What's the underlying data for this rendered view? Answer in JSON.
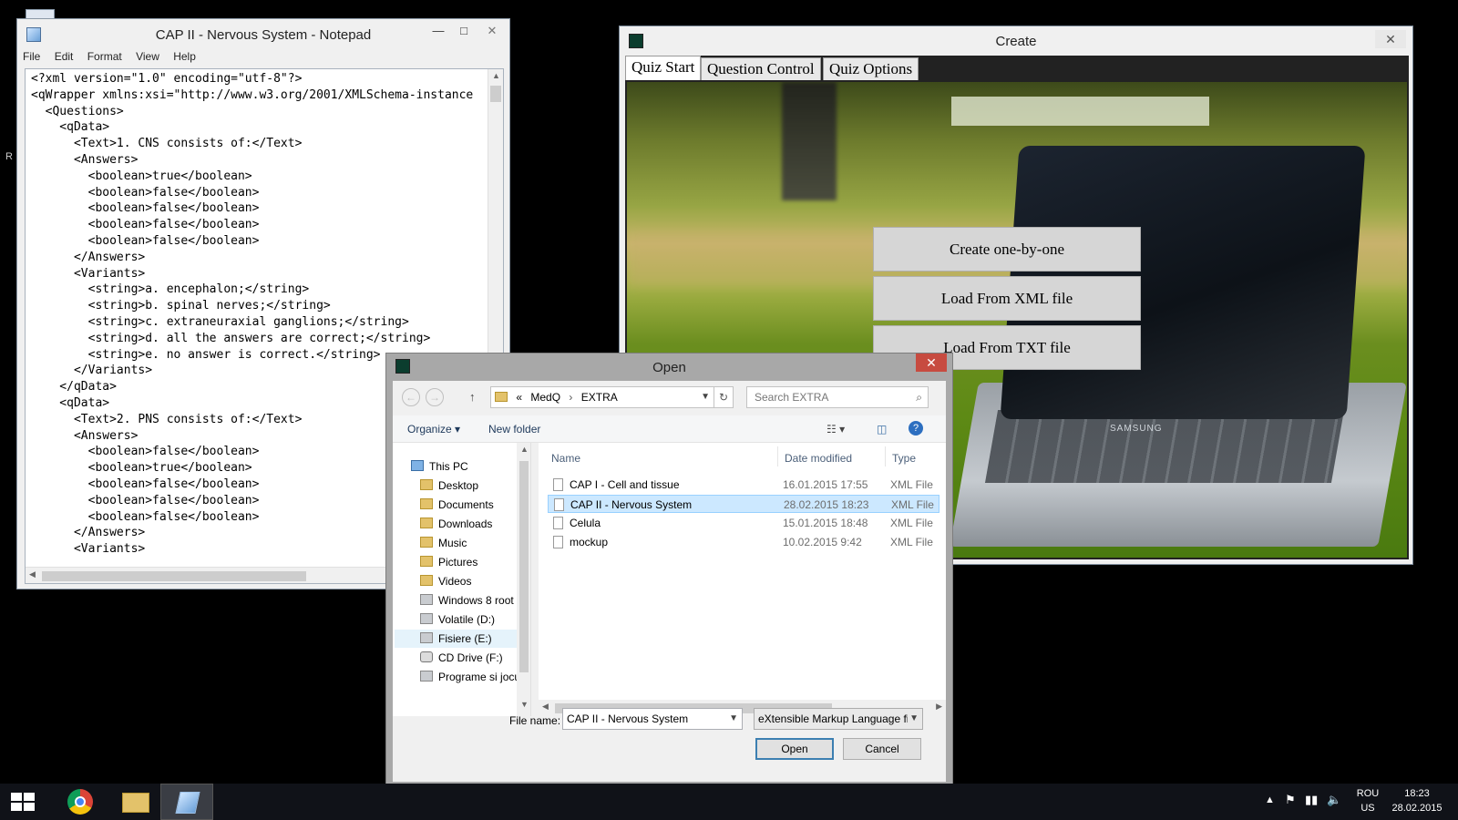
{
  "notepad": {
    "title": "CAP II - Nervous System - Notepad",
    "menu": [
      "File",
      "Edit",
      "Format",
      "View",
      "Help"
    ],
    "minimize": "—",
    "maximize": "□",
    "close": "✕",
    "content": "<?xml version=\"1.0\" encoding=\"utf-8\"?>\n<qWrapper xmlns:xsi=\"http://www.w3.org/2001/XMLSchema-instance\n  <Questions>\n    <qData>\n      <Text>1. CNS consists of:</Text>\n      <Answers>\n        <boolean>true</boolean>\n        <boolean>false</boolean>\n        <boolean>false</boolean>\n        <boolean>false</boolean>\n        <boolean>false</boolean>\n      </Answers>\n      <Variants>\n        <string>a. encephalon;</string>\n        <string>b. spinal nerves;</string>\n        <string>c. extraneuraxial ganglions;</string>\n        <string>d. all the answers are correct;</string>\n        <string>e. no answer is correct.</string>\n      </Variants>\n    </qData>\n    <qData>\n      <Text>2. PNS consists of:</Text>\n      <Answers>\n        <boolean>false</boolean>\n        <boolean>true</boolean>\n        <boolean>false</boolean>\n        <boolean>false</boolean>\n        <boolean>false</boolean>\n      </Answers>\n      <Variants>"
  },
  "create": {
    "title": "Create",
    "close": "✕",
    "tabs": [
      "Quiz Start",
      "Question Control",
      "Quiz Options"
    ],
    "buttons": [
      "Create one-by-one",
      "Load From XML file",
      "Load From TXT file"
    ],
    "brand_on_image": "SAMSUNG"
  },
  "open_dialog": {
    "title": "Open",
    "close": "✕",
    "breadcrumb": [
      "«",
      "MedQ",
      "›",
      "EXTRA"
    ],
    "search_placeholder": "Search EXTRA",
    "organize": "Organize ▾",
    "new_folder": "New folder",
    "tree": [
      {
        "label": "This PC",
        "icon": "computer-icon"
      },
      {
        "label": "Desktop",
        "icon": "folder-icon"
      },
      {
        "label": "Documents",
        "icon": "folder-icon"
      },
      {
        "label": "Downloads",
        "icon": "folder-icon"
      },
      {
        "label": "Music",
        "icon": "folder-icon"
      },
      {
        "label": "Pictures",
        "icon": "folder-icon"
      },
      {
        "label": "Videos",
        "icon": "folder-icon"
      },
      {
        "label": "Windows 8 root (",
        "icon": "drive-icon"
      },
      {
        "label": "Volatile (D:)",
        "icon": "drive-icon"
      },
      {
        "label": "Fisiere (E:)",
        "icon": "drive-icon"
      },
      {
        "label": "CD Drive (F:)",
        "icon": "cd-drive-icon"
      },
      {
        "label": "Programe si jocu",
        "icon": "drive-icon"
      }
    ],
    "columns": [
      "Name",
      "Date modified",
      "Type"
    ],
    "files": [
      {
        "name": "CAP I - Cell and tissue",
        "date": "16.01.2015 17:55",
        "type": "XML File",
        "selected": false
      },
      {
        "name": "CAP II - Nervous System",
        "date": "28.02.2015 18:23",
        "type": "XML File",
        "selected": true
      },
      {
        "name": "Celula",
        "date": "15.01.2015 18:48",
        "type": "XML File",
        "selected": false
      },
      {
        "name": "mockup",
        "date": "10.02.2015 9:42",
        "type": "XML File",
        "selected": false
      }
    ],
    "file_name_label": "File name:",
    "file_name_value": "CAP II - Nervous System",
    "file_type_value": "eXtensible Markup Language fi",
    "open_button": "Open",
    "cancel_button": "Cancel"
  },
  "taskbar": {
    "language": "ROU",
    "layout": "US",
    "time": "18:23",
    "date": "28.02.2015",
    "desktop_fragment": "R"
  }
}
